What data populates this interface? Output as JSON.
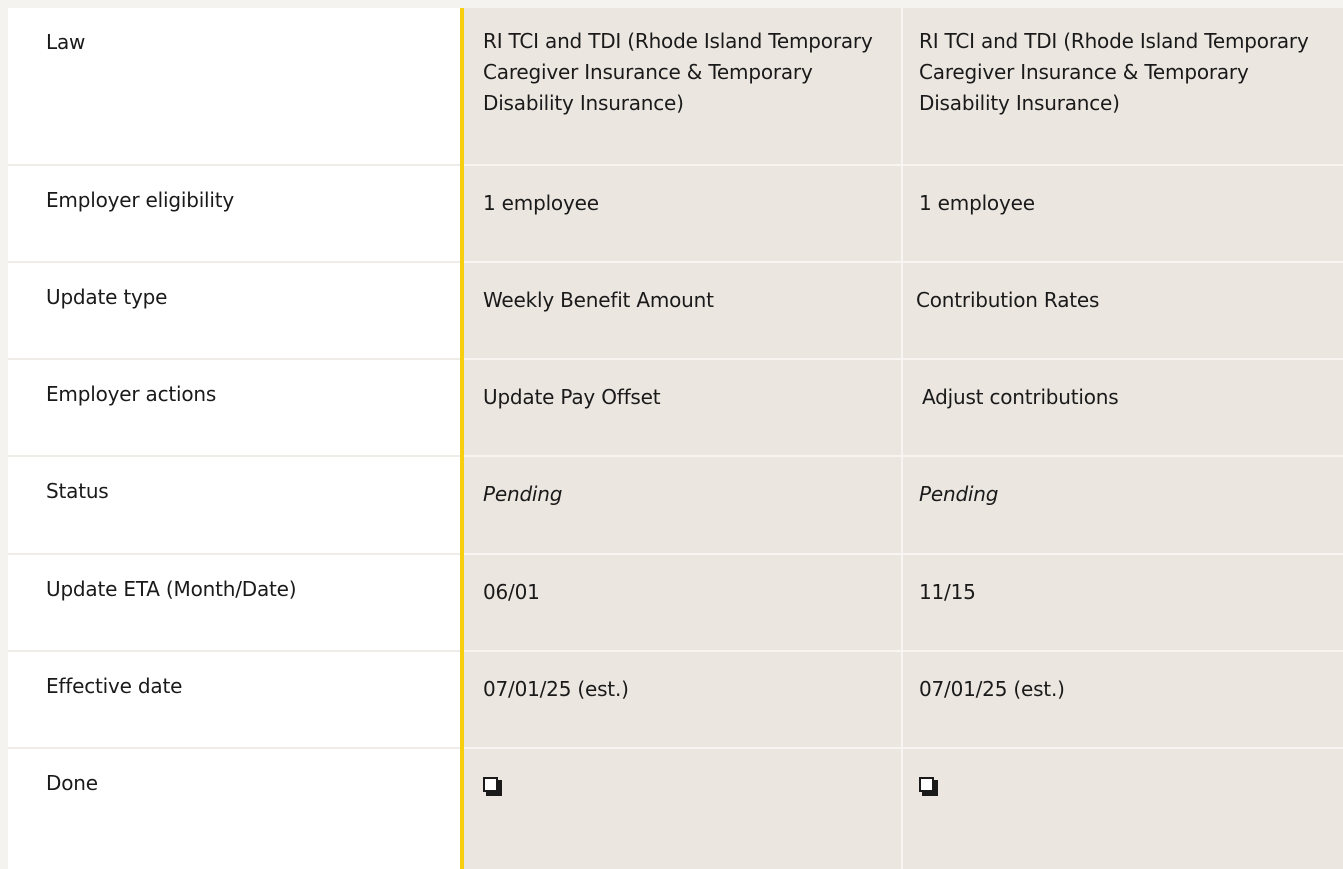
{
  "rows": [
    {
      "label": "Law",
      "col1": "RI TCI and TDI (Rhode Island Temporary Caregiver Insurance & Temporary Disability Insurance)",
      "col2": "RI TCI and TDI (Rhode Island Temporary Caregiver Insurance & Temporary Disability Insurance)"
    },
    {
      "label": "Employer eligibility",
      "col1": "1 employee",
      "col2": "1 employee"
    },
    {
      "label": "Update type",
      "col1": "Weekly Benefit Amount",
      "col2": "Contribution Rates"
    },
    {
      "label": "Employer actions",
      "col1": "Update Pay Offset",
      "col2": "Adjust contributions"
    },
    {
      "label": "Status",
      "col1": "Pending",
      "col2": "Pending"
    },
    {
      "label": "Update ETA (Month/Date)",
      "col1": "06/01",
      "col2": "11/15"
    },
    {
      "label": "Effective date",
      "col1": "07/01/25 (est.)",
      "col2": "07/01/25 (est.)"
    },
    {
      "label": "Done",
      "col1_checkbox": "unchecked",
      "col2_checkbox": "unchecked"
    }
  ],
  "colors": {
    "accent": "#f7cf0f",
    "label_bg": "#ffffff",
    "value_bg": "#ebe6e0"
  }
}
